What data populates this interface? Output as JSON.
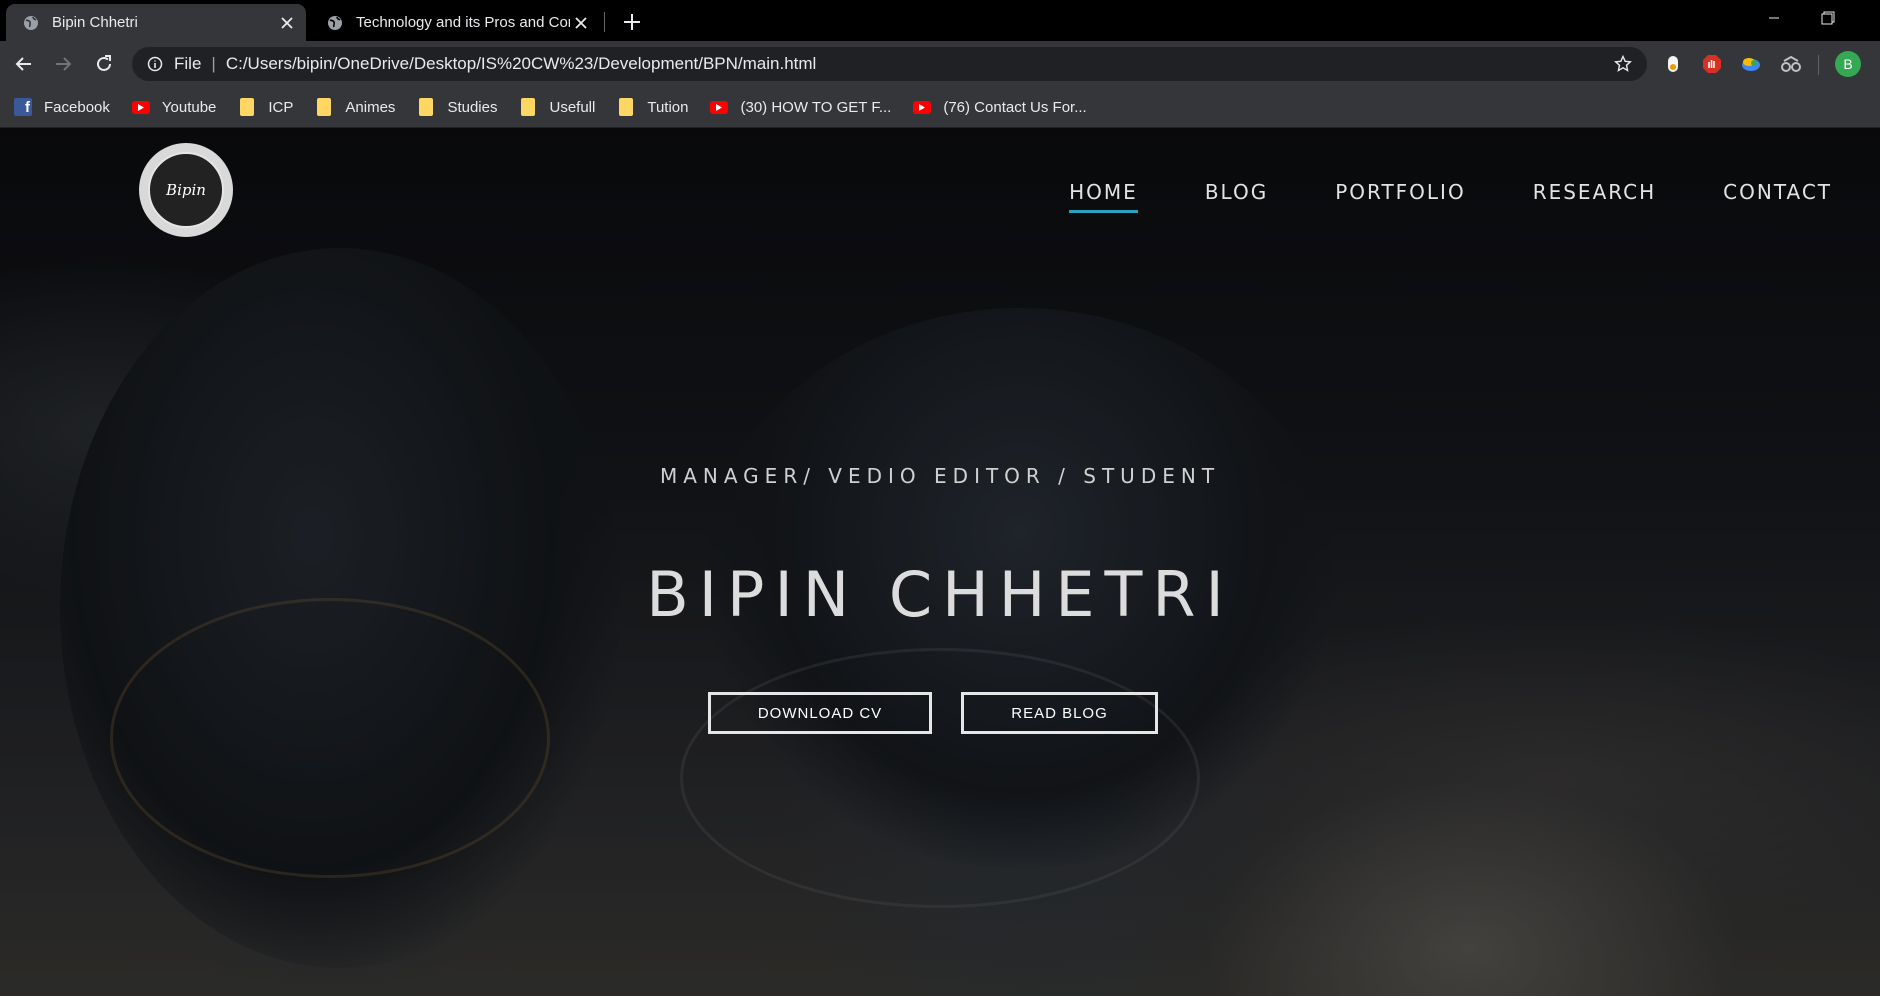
{
  "browser": {
    "tabs": [
      {
        "title": "Bipin Chhetri",
        "active": true
      },
      {
        "title": "Technology and its Pros and Cons",
        "active": false
      }
    ],
    "address": {
      "scheme": "File",
      "url": "C:/Users/bipin/OneDrive/Desktop/IS%20CW%23/Development/BPN/main.html"
    },
    "profile_initial": "B",
    "bookmarks": [
      {
        "label": "Facebook",
        "icon": "facebook-icon"
      },
      {
        "label": "Youtube",
        "icon": "youtube-icon"
      },
      {
        "label": "ICP",
        "icon": "folder-icon"
      },
      {
        "label": "Animes",
        "icon": "folder-icon"
      },
      {
        "label": "Studies",
        "icon": "folder-icon"
      },
      {
        "label": "Usefull",
        "icon": "folder-icon"
      },
      {
        "label": "Tution",
        "icon": "folder-icon"
      },
      {
        "label": "(30) HOW TO GET F...",
        "icon": "youtube-icon"
      },
      {
        "label": "(76) Contact Us For...",
        "icon": "youtube-icon"
      }
    ]
  },
  "site": {
    "logo_text": "Bipin",
    "nav": [
      "HOME",
      "BLOG",
      "PORTFOLIO",
      "RESEARCH",
      "CONTACT"
    ],
    "active_nav": "HOME",
    "accent_color": "#2aa1c0",
    "hero": {
      "subtitle": "MANAGER/ VEDIO EDITOR / STUDENT",
      "title": "BIPIN CHHETRI",
      "buttons": {
        "cv": "DOWNLOAD CV",
        "blog": "READ BLOG"
      }
    }
  }
}
